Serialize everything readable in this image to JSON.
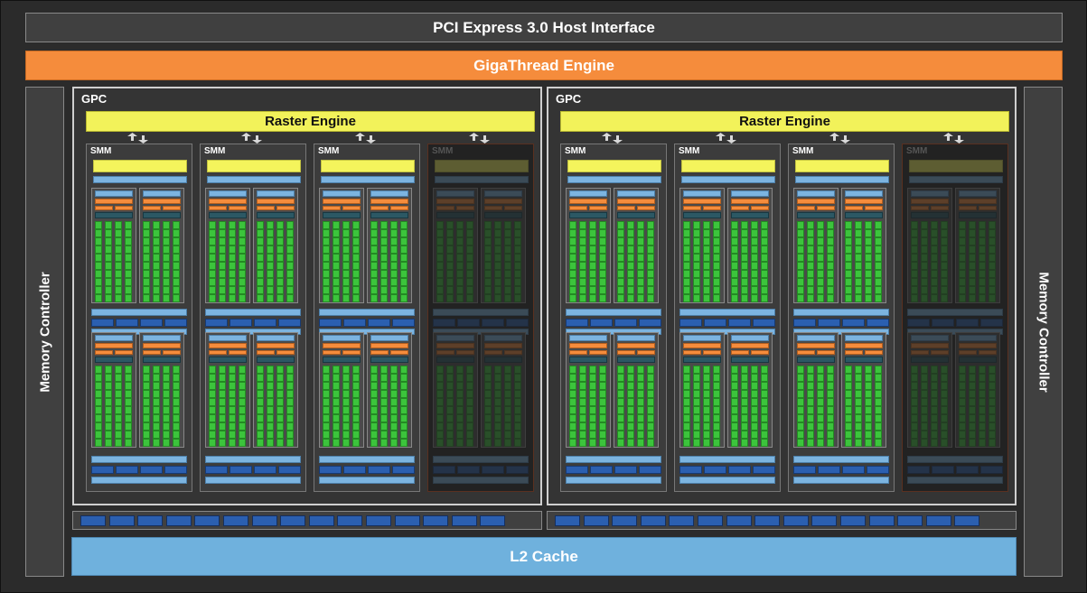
{
  "pcie_label": "PCI Express 3.0 Host Interface",
  "gigathread_label": "GigaThread Engine",
  "memory_controller_label": "Memory Controller",
  "l2_label": "L2 Cache",
  "gpcs": [
    {
      "label": "GPC",
      "raster_label": "Raster Engine",
      "smms": [
        {
          "label": "SMM",
          "disabled": false
        },
        {
          "label": "SMM",
          "disabled": false
        },
        {
          "label": "SMM",
          "disabled": false
        },
        {
          "label": "SMM",
          "disabled": true
        }
      ]
    },
    {
      "label": "GPC",
      "raster_label": "Raster Engine",
      "smms": [
        {
          "label": "SMM",
          "disabled": false
        },
        {
          "label": "SMM",
          "disabled": false
        },
        {
          "label": "SMM",
          "disabled": false
        },
        {
          "label": "SMM",
          "disabled": true
        }
      ]
    }
  ],
  "colors": {
    "background": "#2b2b2b",
    "gigathread": "#f58c3c",
    "raster_engine": "#f2f25a",
    "cuda_core": "#3cc43c",
    "l2_cache": "#6fb1dd",
    "memory_block": "#2b5fb0"
  },
  "icons": {
    "raster_to_smm_link": "double-arrow-icon"
  }
}
